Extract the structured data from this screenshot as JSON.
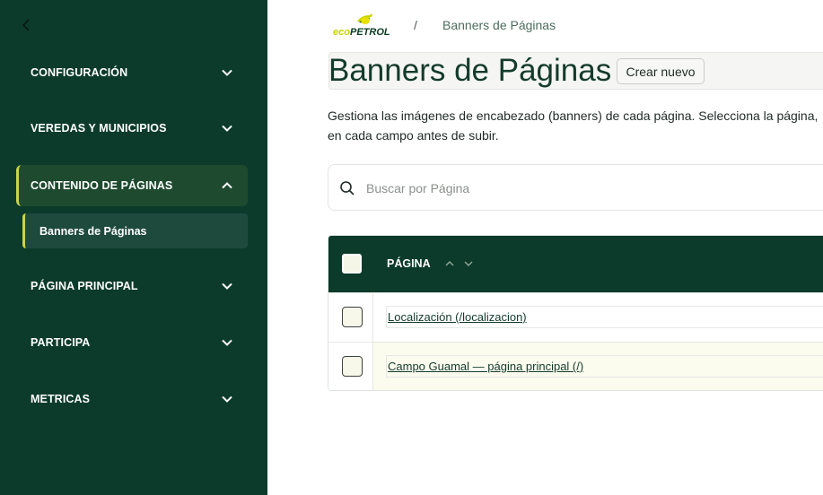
{
  "sidebar": {
    "back_icon": "chevron-left-icon",
    "items": [
      {
        "label": "CONFIGURACIÓN",
        "expanded": false
      },
      {
        "label": "VEREDAS Y MUNICIPIOS",
        "expanded": false
      },
      {
        "label": "CONTENIDO DE PÁGINAS",
        "expanded": true,
        "children": [
          {
            "label": "Banners de Páginas",
            "active": true
          }
        ]
      },
      {
        "label": "PÁGINA PRINCIPAL",
        "expanded": false
      },
      {
        "label": "PARTICIPA",
        "expanded": false
      },
      {
        "label": "METRICAS",
        "expanded": false
      }
    ]
  },
  "header": {
    "logo_text": "ecopetrol",
    "breadcrumb_separator": "/",
    "breadcrumb_current": "Banners de Páginas"
  },
  "page": {
    "title": "Banners de Páginas",
    "create_button": "Crear nuevo",
    "description_line1": "Gestiona las imágenes de encabezado (banners) de cada página. Selecciona la página,",
    "description_line2": "en cada campo antes de subir."
  },
  "search": {
    "placeholder": "Buscar por Página",
    "value": ""
  },
  "table": {
    "column_header": "PÁGINA",
    "rows": [
      {
        "label": "Localización (/localizacion)"
      },
      {
        "label": "Campo Guamal — página principal (/)"
      }
    ]
  },
  "colors": {
    "sidebar_bg": "#0c3b2b",
    "accent": "#c8d44a",
    "text_dark": "#143b2c"
  }
}
